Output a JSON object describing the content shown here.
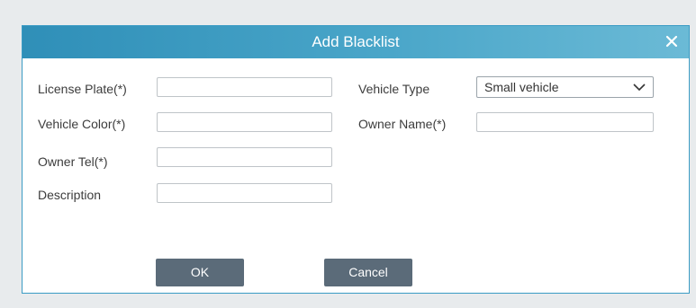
{
  "dialog": {
    "title": "Add Blacklist",
    "close_icon": "close-icon"
  },
  "form": {
    "license_plate": {
      "label": "License Plate(*)",
      "value": ""
    },
    "vehicle_type": {
      "label": "Vehicle Type",
      "value": "Small vehicle",
      "icon": "chevron-down-icon"
    },
    "vehicle_color": {
      "label": "Vehicle Color(*)",
      "value": ""
    },
    "owner_name": {
      "label": "Owner Name(*)",
      "value": ""
    },
    "owner_tel": {
      "label": "Owner Tel(*)",
      "value": ""
    },
    "description": {
      "label": "Description",
      "value": ""
    }
  },
  "buttons": {
    "ok": "OK",
    "cancel": "Cancel"
  },
  "colors": {
    "titlebar": "#2f8fb8",
    "button": "#5b6b79"
  }
}
